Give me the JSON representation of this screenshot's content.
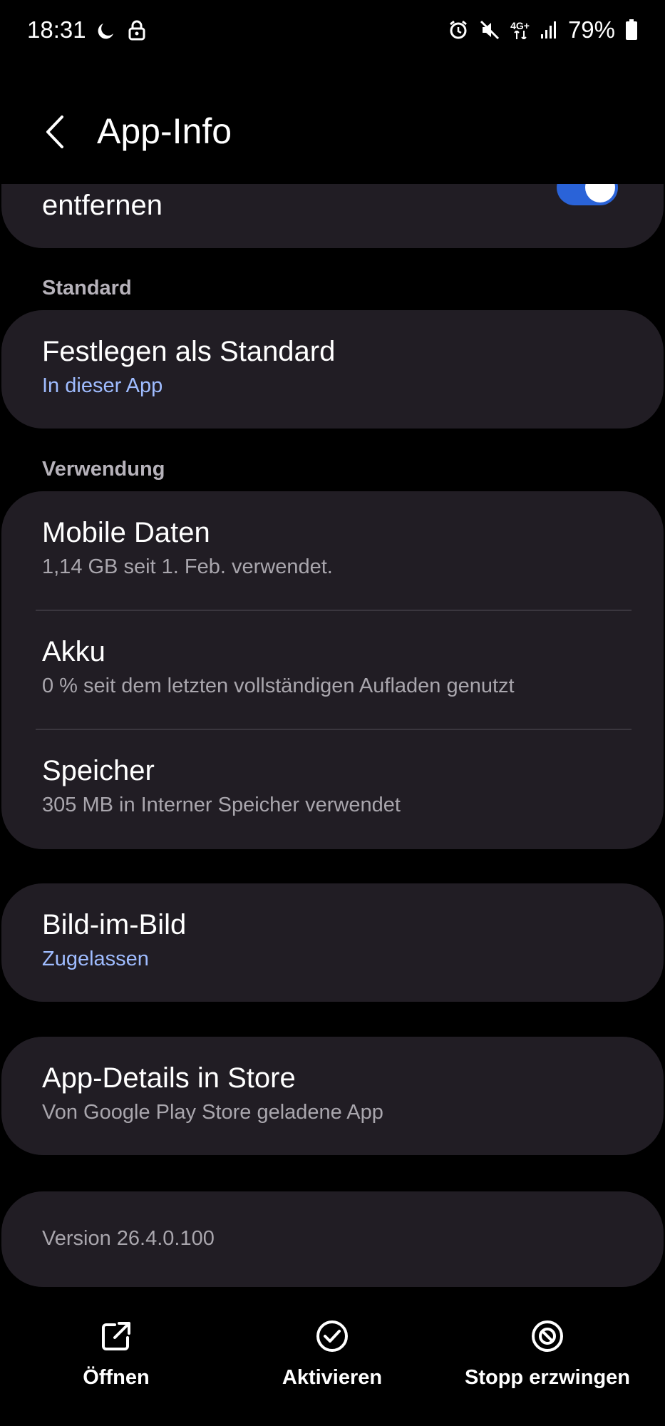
{
  "status_bar": {
    "time": "18:31",
    "battery_percent": "79%",
    "network": "4G+",
    "left_icons": [
      "dnd-moon-icon",
      "lock-icon"
    ],
    "right_icons": [
      "alarm-icon",
      "mute-icon",
      "network-4g-icon",
      "signal-icon",
      "battery-icon"
    ]
  },
  "header": {
    "title": "App-Info",
    "back_icon": "back-arrow-icon"
  },
  "top_card": {
    "text_fragment": "entfernen",
    "toggle_on": true
  },
  "sections": {
    "standard_label": "Standard",
    "usage_label": "Verwendung"
  },
  "default_card": {
    "title": "Festlegen als Standard",
    "subtitle": "In dieser App"
  },
  "usage_items": [
    {
      "title": "Mobile Daten",
      "subtitle": "1,14 GB seit 1. Feb. verwendet."
    },
    {
      "title": "Akku",
      "subtitle": "0 % seit dem letzten vollständigen Aufladen genutzt"
    },
    {
      "title": "Speicher",
      "subtitle": "305 MB in Interner Speicher verwendet"
    }
  ],
  "pip_card": {
    "title": "Bild-im-Bild",
    "subtitle": "Zugelassen"
  },
  "store_card": {
    "title": "App-Details in Store",
    "subtitle": "Von Google Play Store geladene App"
  },
  "version_card": {
    "text": "Version 26.4.0.100"
  },
  "bottom_actions": [
    {
      "label": "Öffnen",
      "icon": "open-external-icon"
    },
    {
      "label": "Aktivieren",
      "icon": "check-circle-icon"
    },
    {
      "label": "Stopp erzwingen",
      "icon": "block-icon"
    }
  ],
  "colors": {
    "background": "#000000",
    "card": "#211d24",
    "accent_link": "#9fbcff",
    "toggle_on": "#2a63d8",
    "secondary_text": "#a9a6ad"
  }
}
